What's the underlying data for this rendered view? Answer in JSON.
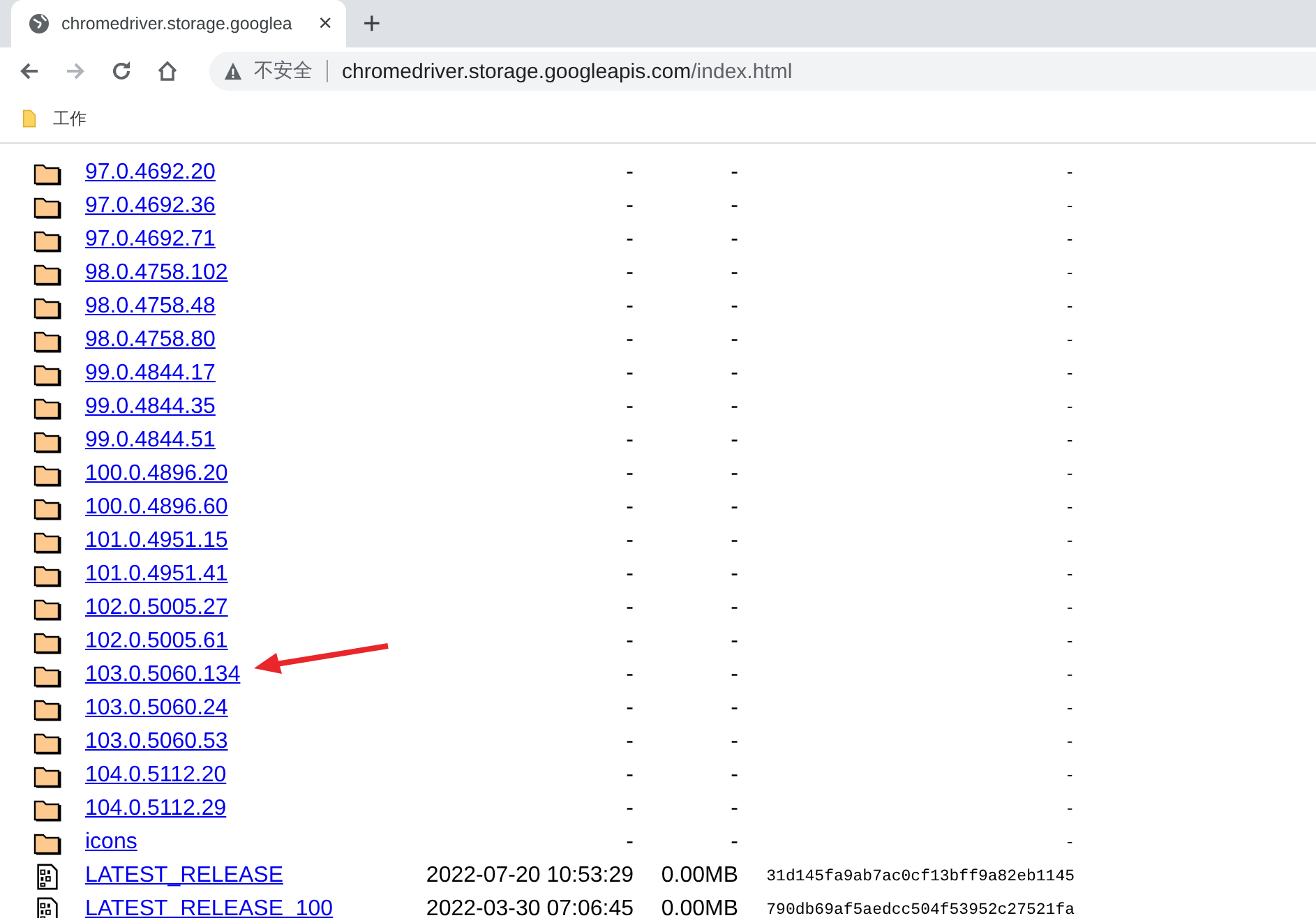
{
  "tab": {
    "title": "chromedriver.storage.googlea",
    "close": "×"
  },
  "new_tab": "+",
  "address": {
    "security": "不安全",
    "host": "chromedriver.storage.googleapis.com",
    "path": "/index.html"
  },
  "bookmarks": [
    {
      "label": "工作"
    }
  ],
  "rows": [
    {
      "kind": "folder",
      "name": "97.0.4692.20",
      "modified": "-",
      "size": "-",
      "md5": "-",
      "annotated": false
    },
    {
      "kind": "folder",
      "name": "97.0.4692.36",
      "modified": "-",
      "size": "-",
      "md5": "-",
      "annotated": false
    },
    {
      "kind": "folder",
      "name": "97.0.4692.71",
      "modified": "-",
      "size": "-",
      "md5": "-",
      "annotated": false
    },
    {
      "kind": "folder",
      "name": "98.0.4758.102",
      "modified": "-",
      "size": "-",
      "md5": "-",
      "annotated": false
    },
    {
      "kind": "folder",
      "name": "98.0.4758.48",
      "modified": "-",
      "size": "-",
      "md5": "-",
      "annotated": false
    },
    {
      "kind": "folder",
      "name": "98.0.4758.80",
      "modified": "-",
      "size": "-",
      "md5": "-",
      "annotated": false
    },
    {
      "kind": "folder",
      "name": "99.0.4844.17",
      "modified": "-",
      "size": "-",
      "md5": "-",
      "annotated": false
    },
    {
      "kind": "folder",
      "name": "99.0.4844.35",
      "modified": "-",
      "size": "-",
      "md5": "-",
      "annotated": false
    },
    {
      "kind": "folder",
      "name": "99.0.4844.51",
      "modified": "-",
      "size": "-",
      "md5": "-",
      "annotated": false
    },
    {
      "kind": "folder",
      "name": "100.0.4896.20",
      "modified": "-",
      "size": "-",
      "md5": "-",
      "annotated": false
    },
    {
      "kind": "folder",
      "name": "100.0.4896.60",
      "modified": "-",
      "size": "-",
      "md5": "-",
      "annotated": false
    },
    {
      "kind": "folder",
      "name": "101.0.4951.15",
      "modified": "-",
      "size": "-",
      "md5": "-",
      "annotated": false
    },
    {
      "kind": "folder",
      "name": "101.0.4951.41",
      "modified": "-",
      "size": "-",
      "md5": "-",
      "annotated": false
    },
    {
      "kind": "folder",
      "name": "102.0.5005.27",
      "modified": "-",
      "size": "-",
      "md5": "-",
      "annotated": false
    },
    {
      "kind": "folder",
      "name": "102.0.5005.61",
      "modified": "-",
      "size": "-",
      "md5": "-",
      "annotated": false
    },
    {
      "kind": "folder",
      "name": "103.0.5060.134",
      "modified": "-",
      "size": "-",
      "md5": "-",
      "annotated": true
    },
    {
      "kind": "folder",
      "name": "103.0.5060.24",
      "modified": "-",
      "size": "-",
      "md5": "-",
      "annotated": false
    },
    {
      "kind": "folder",
      "name": "103.0.5060.53",
      "modified": "-",
      "size": "-",
      "md5": "-",
      "annotated": false
    },
    {
      "kind": "folder",
      "name": "104.0.5112.20",
      "modified": "-",
      "size": "-",
      "md5": "-",
      "annotated": false
    },
    {
      "kind": "folder",
      "name": "104.0.5112.29",
      "modified": "-",
      "size": "-",
      "md5": "-",
      "annotated": false
    },
    {
      "kind": "folder",
      "name": "icons",
      "modified": "-",
      "size": "-",
      "md5": "-",
      "annotated": false
    },
    {
      "kind": "file",
      "name": "LATEST_RELEASE",
      "modified": "2022-07-20 10:53:29",
      "size": "0.00MB",
      "md5": "31d145fa9ab7ac0cf13bff9a82eb1145",
      "annotated": false
    },
    {
      "kind": "file",
      "name": "LATEST_RELEASE_100",
      "modified": "2022-03-30 07:06:45",
      "size": "0.00MB",
      "md5": "790db69af5aedcc504f53952c27521fa",
      "annotated": false
    }
  ]
}
